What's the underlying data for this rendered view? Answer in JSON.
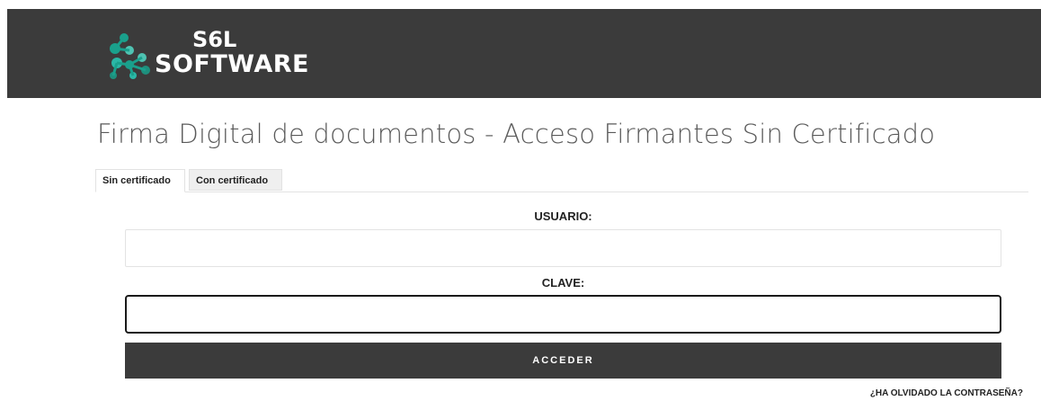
{
  "header": {
    "logo_line1": "S6L",
    "logo_line2": "SOFTWARE",
    "logo_colors": [
      "#1aa08c",
      "#2bb7a6",
      "#4fc3b2",
      "#1e8f7d"
    ]
  },
  "page": {
    "title": "Firma Digital de documentos - Acceso Firmantes Sin Certificado"
  },
  "tabs": [
    {
      "label": "Sin certificado",
      "active": true
    },
    {
      "label": "Con certificado",
      "active": false
    }
  ],
  "form": {
    "user_label": "USUARIO:",
    "user_value": "",
    "password_label": "CLAVE:",
    "password_value": "",
    "submit_label": "ACCEDER",
    "forgot_label": "¿HA OLVIDADO LA CONTRASEÑA?"
  }
}
